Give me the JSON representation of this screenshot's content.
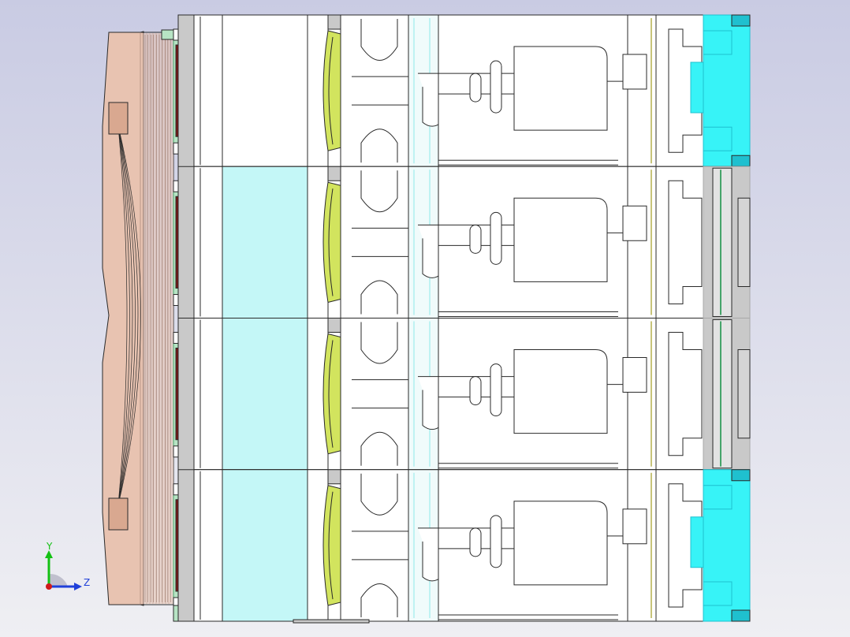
{
  "viewport": {
    "bg_top": "#c9cbe3",
    "bg_bottom": "#eeeef3"
  },
  "colors": {
    "outline": "#2a2a2a",
    "part_white": "#ffffff",
    "peach": "#e8c3b1",
    "peach_dark": "#d9a890",
    "maroon": "#7a1414",
    "pale_cyan": "#c4f7f7",
    "olive_yellow": "#d2e45e",
    "olive_yellow_dark": "#a9b93a",
    "bright_cyan": "#37f3f7",
    "cyan_dark": "#1fc0cf",
    "mint": "#b7e4c4",
    "green_edge": "#46a46a",
    "grey": "#c9c9c9",
    "grey_dark": "#a9a9a9",
    "axis_x": "#1f3fd9",
    "axis_y": "#14c114",
    "axis_z": "#d01a1a"
  },
  "model": {
    "name": "busbar-module-section",
    "module_count": 4
  },
  "triad": {
    "x_label": "Y",
    "z_label": "Z",
    "icon": "coordinate-triad-icon"
  }
}
